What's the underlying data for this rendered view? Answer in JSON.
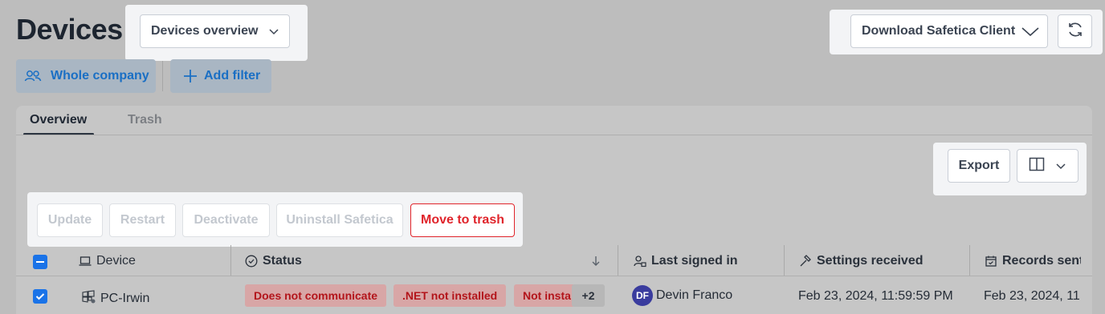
{
  "header": {
    "title": "Devices",
    "view_dropdown": {
      "label": "Devices overview"
    },
    "download_button": {
      "label": "Download Safetica Client"
    }
  },
  "filters": {
    "scope": "Whole company",
    "add_filter": "Add filter"
  },
  "tabs": [
    {
      "label": "Overview",
      "active": true
    },
    {
      "label": "Trash",
      "active": false
    }
  ],
  "toolbar": {
    "export": "Export"
  },
  "actions": {
    "update": "Update",
    "restart": "Restart",
    "deactivate": "Deactivate",
    "uninstall": "Uninstall Safetica",
    "move_to_trash": "Move to trash"
  },
  "table": {
    "columns": {
      "device": "Device",
      "status": "Status",
      "last_signed_in": "Last signed in",
      "settings_received": "Settings received",
      "records_sent": "Records sent"
    },
    "rows": [
      {
        "device": "PC-Irwin",
        "statuses": [
          "Does not communicate",
          ".NET not installed",
          "Not insta"
        ],
        "more": "+2",
        "user_initials": "DF",
        "user": "Devin Franco",
        "settings_received": "Feb 23, 2024, 11:59:59 PM",
        "records_sent": "Feb 23, 2024, 11"
      }
    ]
  },
  "colors": {
    "accent": "#1a73e8",
    "danger": "#e0242b",
    "link": "#1a6fc4",
    "avatar": "#3a3c9e"
  }
}
